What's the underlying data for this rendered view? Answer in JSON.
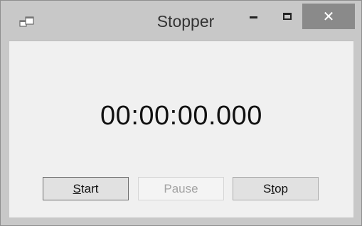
{
  "window": {
    "title": "Stopper",
    "icons": {
      "app": "app-window-icon",
      "minimize": "minimize-icon",
      "maximize": "maximize-icon",
      "close": "close-icon"
    },
    "close_glyph": "✕"
  },
  "timer": {
    "display": "00:00:00.000"
  },
  "buttons": {
    "start": {
      "mnemonic": "S",
      "rest": "tart",
      "enabled": true
    },
    "pause": {
      "label": "Pause",
      "enabled": false
    },
    "stop": {
      "before": "S",
      "mnemonic": "t",
      "after": "op",
      "enabled": true
    }
  },
  "colors": {
    "frame": "#c8c8c8",
    "client": "#f0f0f0",
    "close_button": "#8a8a8a",
    "disabled_text": "#a3a3a3"
  }
}
